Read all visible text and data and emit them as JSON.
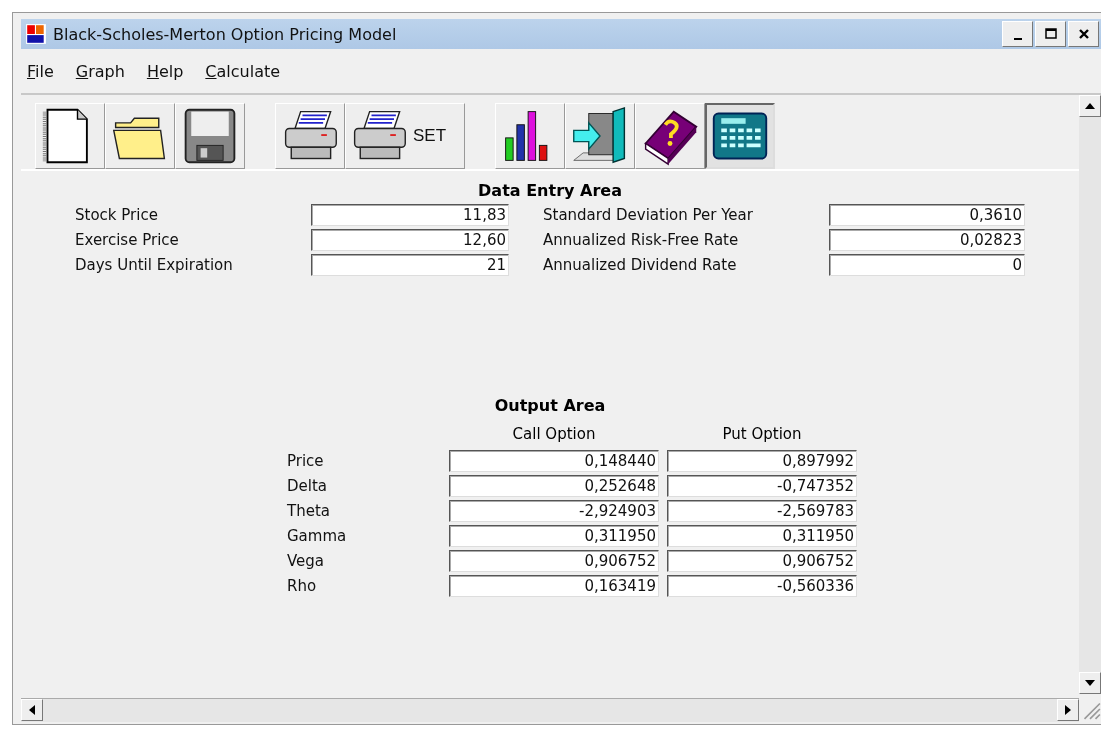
{
  "window": {
    "title": "Black-Scholes-Merton Option Pricing Model"
  },
  "menu": [
    {
      "label": "File",
      "underline_first": true
    },
    {
      "label": "Graph",
      "underline_first": true
    },
    {
      "label": "Help",
      "underline_first": true
    },
    {
      "label": "Calculate",
      "underline_first": true
    }
  ],
  "toolbar": [
    {
      "kind": "new",
      "pressed": false
    },
    {
      "kind": "open",
      "pressed": false
    },
    {
      "kind": "save",
      "pressed": false
    },
    {
      "kind": "gap"
    },
    {
      "kind": "print",
      "pressed": false
    },
    {
      "kind": "print-setup",
      "label": "SET",
      "pressed": false
    },
    {
      "kind": "gap"
    },
    {
      "kind": "chart",
      "pressed": false
    },
    {
      "kind": "exit",
      "pressed": false
    },
    {
      "kind": "help",
      "pressed": false
    },
    {
      "kind": "calculator",
      "pressed": true
    }
  ],
  "data_entry": {
    "title": "Data Entry Area",
    "left": [
      {
        "label": "Stock Price",
        "value": "11,83"
      },
      {
        "label": "Exercise Price",
        "value": "12,60"
      },
      {
        "label": "Days Until Expiration",
        "value": "21"
      }
    ],
    "right": [
      {
        "label": "Standard Deviation Per Year",
        "value": "0,3610"
      },
      {
        "label": "Annualized Risk-Free Rate",
        "value": "0,02823"
      },
      {
        "label": "Annualized Dividend Rate",
        "value": "0"
      }
    ]
  },
  "output": {
    "title": "Output Area",
    "columns": [
      "Call Option",
      "Put Option"
    ],
    "rows": [
      {
        "label": "Price",
        "values": [
          "0,148440",
          "0,897992"
        ]
      },
      {
        "label": "Delta",
        "values": [
          "0,252648",
          "-0,747352"
        ]
      },
      {
        "label": "Theta",
        "values": [
          "-2,924903",
          "-2,569783"
        ]
      },
      {
        "label": "Gamma",
        "values": [
          "0,311950",
          "0,311950"
        ]
      },
      {
        "label": "Vega",
        "values": [
          "0,906752",
          "0,906752"
        ]
      },
      {
        "label": "Rho",
        "values": [
          "0,163419",
          "-0,560336"
        ]
      }
    ]
  }
}
